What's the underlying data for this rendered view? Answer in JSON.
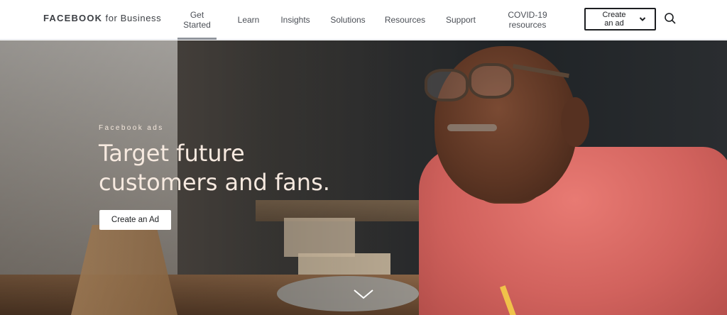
{
  "header": {
    "logo_bold": "FACEBOOK",
    "logo_rest": "for Business",
    "nav": [
      {
        "label": "Get\nStarted",
        "active": true
      },
      {
        "label": "Learn",
        "active": false
      },
      {
        "label": "Insights",
        "active": false
      },
      {
        "label": "Solutions",
        "active": false
      },
      {
        "label": "Resources",
        "active": false
      },
      {
        "label": "Support",
        "active": false
      },
      {
        "label": "COVID-19\nresources",
        "active": false
      }
    ],
    "create_button_label": "Create an ad",
    "icons": {
      "create_dropdown": "chevron-down-icon",
      "search": "search-icon"
    }
  },
  "hero": {
    "eyebrow": "Facebook ads",
    "headline": "Target future customers and fans.",
    "cta_label": "Create an Ad",
    "scroll_icon": "chevron-down-icon"
  },
  "colors": {
    "nav_text": "#4b4f56",
    "active_underline": "#90949c",
    "hero_text": "#f6e9df"
  }
}
